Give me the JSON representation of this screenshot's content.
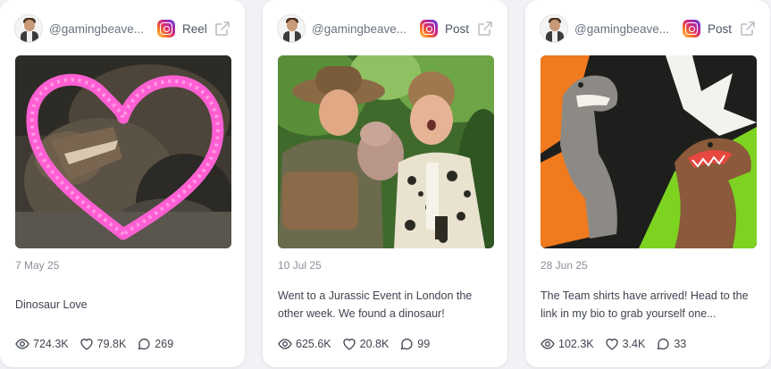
{
  "cards": [
    {
      "handle": "@gamingbeave...",
      "platform_icon": "instagram-icon",
      "post_type": "Reel",
      "date": "7 May 25",
      "caption": "Dinosaur Love",
      "stats": {
        "views": "724.3K",
        "likes": "79.8K",
        "comments": "269"
      }
    },
    {
      "handle": "@gamingbeave...",
      "platform_icon": "instagram-icon",
      "post_type": "Post",
      "date": "10 Jul 25",
      "caption": "Went to a Jurassic Event in London the other week. We found a dinosaur!",
      "stats": {
        "views": "625.6K",
        "likes": "20.8K",
        "comments": "99"
      }
    },
    {
      "handle": "@gamingbeave...",
      "platform_icon": "instagram-icon",
      "post_type": "Post",
      "date": "28 Jun 25",
      "caption": "The Team shirts have arrived! Head to the link in my bio to grab yourself one...",
      "stats": {
        "views": "102.3K",
        "likes": "3.4K",
        "comments": "33"
      }
    }
  ],
  "colors": {
    "background": "#f1f2f5",
    "card": "#ffffff",
    "muted_text": "#8a8f98",
    "body_text": "#3f4450",
    "heart_scribble": "#ff5fd2"
  }
}
